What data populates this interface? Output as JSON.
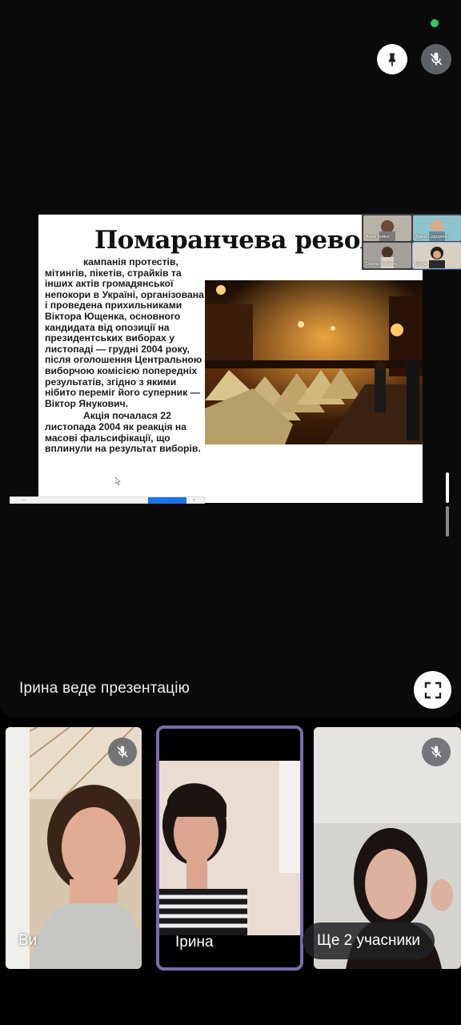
{
  "presentation": {
    "slide_title": "Помаранчева революція",
    "paragraph_1": "кампанія протестів, мітингів, пікетів, страйків та інших актів громадянської непокори в Україні, організована і проведена прихильниками Віктора Ющенка, основного кандидата від опозиції на президентських виборах у листопаді — грудні 2004 року, після оголошення Центральною виборчою комісією попередніх результатів, згідно з якими нібито переміг його суперник — Віктор Янукович.",
    "paragraph_2": "Акція почалася 22 листопада 2004 як реакція на масові фальсифікації, що вплинули на результат виборів.",
    "presenter_status": "Ірина веде презентацію"
  },
  "mini_participants": [
    "Анна Бойко",
    "Діана Сидоренко",
    "Dasha Pershina",
    "Ірина"
  ],
  "tiles": [
    {
      "label": "Ви",
      "muted": true
    },
    {
      "label": "Ірина",
      "muted": false,
      "active": true
    },
    {
      "label": "Ще 2 учасники",
      "muted": true
    }
  ],
  "controls": {
    "pin": "pin-icon",
    "mic": "mic-off-icon",
    "fullscreen": "fullscreen-icon"
  },
  "colors": {
    "active_border": "#7c6bb0",
    "status_dot": "#34c759"
  }
}
